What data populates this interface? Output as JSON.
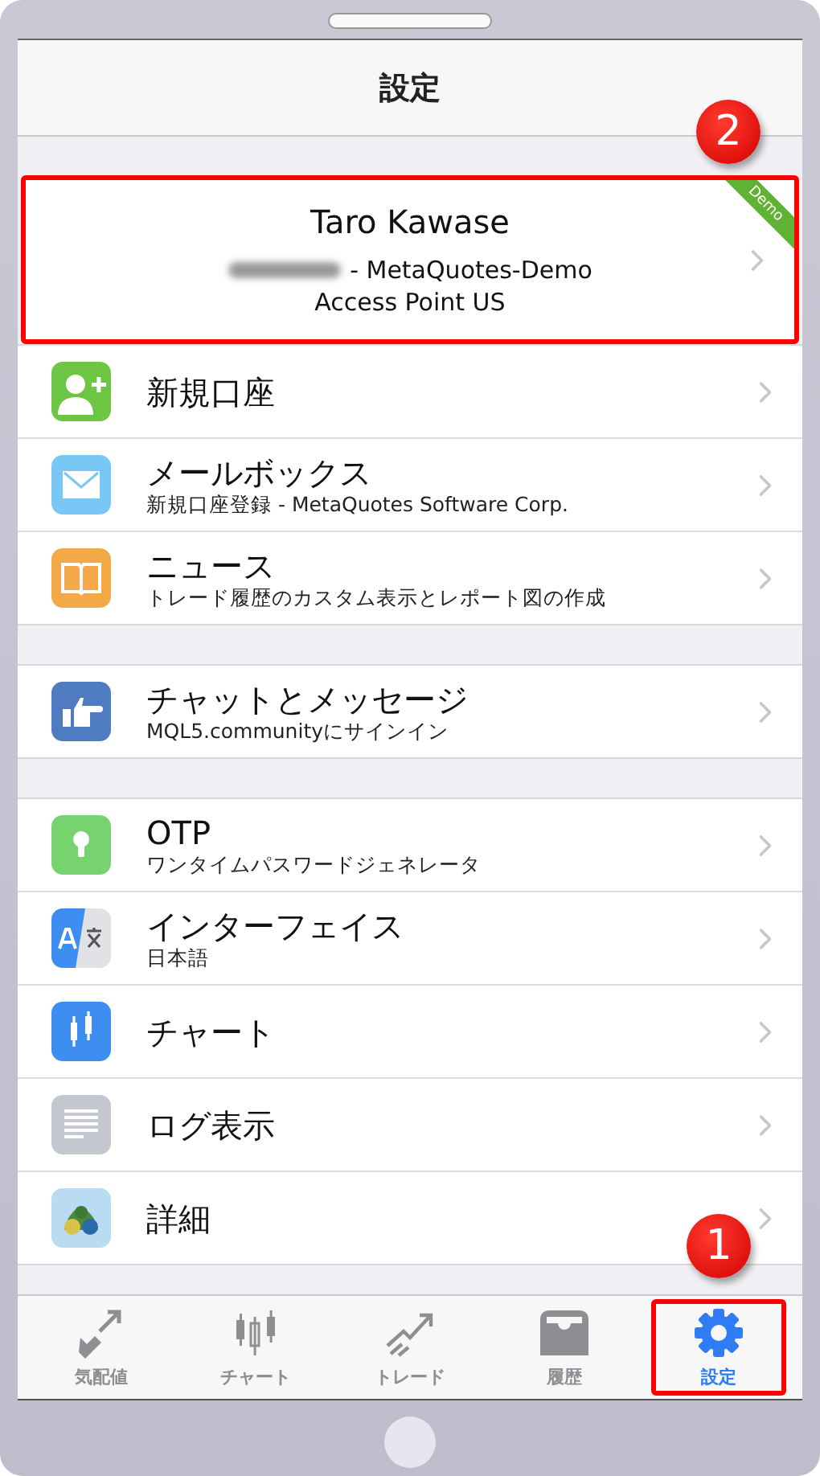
{
  "header": {
    "title": "設定"
  },
  "account": {
    "name": "Taro Kawase",
    "server": "- MetaQuotes-Demo",
    "access_point": "Access Point US",
    "ribbon": "Demo",
    "highlighted": true
  },
  "sections": [
    {
      "rows": [
        {
          "kind": "person-add",
          "title": "新規口座"
        },
        {
          "kind": "mail",
          "title": "メールボックス",
          "subtitle": "新規口座登録 - MetaQuotes Software Corp."
        },
        {
          "kind": "book",
          "title": "ニュース",
          "subtitle": "トレード履歴のカスタム表示とレポート図の作成"
        }
      ]
    },
    {
      "rows": [
        {
          "kind": "thumb",
          "title": "チャットとメッセージ",
          "subtitle": "MQL5.communityにサインイン"
        }
      ]
    },
    {
      "rows": [
        {
          "kind": "key",
          "title": "OTP",
          "subtitle": "ワンタイムパスワードジェネレータ"
        },
        {
          "kind": "translate",
          "title": "インターフェイス",
          "subtitle": "日本語"
        },
        {
          "kind": "candles",
          "title": "チャート"
        },
        {
          "kind": "log",
          "title": "ログ表示"
        },
        {
          "kind": "logo",
          "title": "詳細"
        }
      ]
    }
  ],
  "tab_bar": [
    {
      "kind": "arrows",
      "label": "気配値",
      "selected": false,
      "highlighted": false
    },
    {
      "kind": "candles",
      "label": "チャート",
      "selected": false,
      "highlighted": false
    },
    {
      "kind": "trend",
      "label": "トレード",
      "selected": false,
      "highlighted": false
    },
    {
      "kind": "inbox",
      "label": "履歴",
      "selected": false,
      "highlighted": false
    },
    {
      "kind": "gear",
      "label": "設定",
      "selected": true,
      "highlighted": true
    }
  ],
  "callouts": [
    {
      "label": "2"
    },
    {
      "label": "1"
    }
  ]
}
